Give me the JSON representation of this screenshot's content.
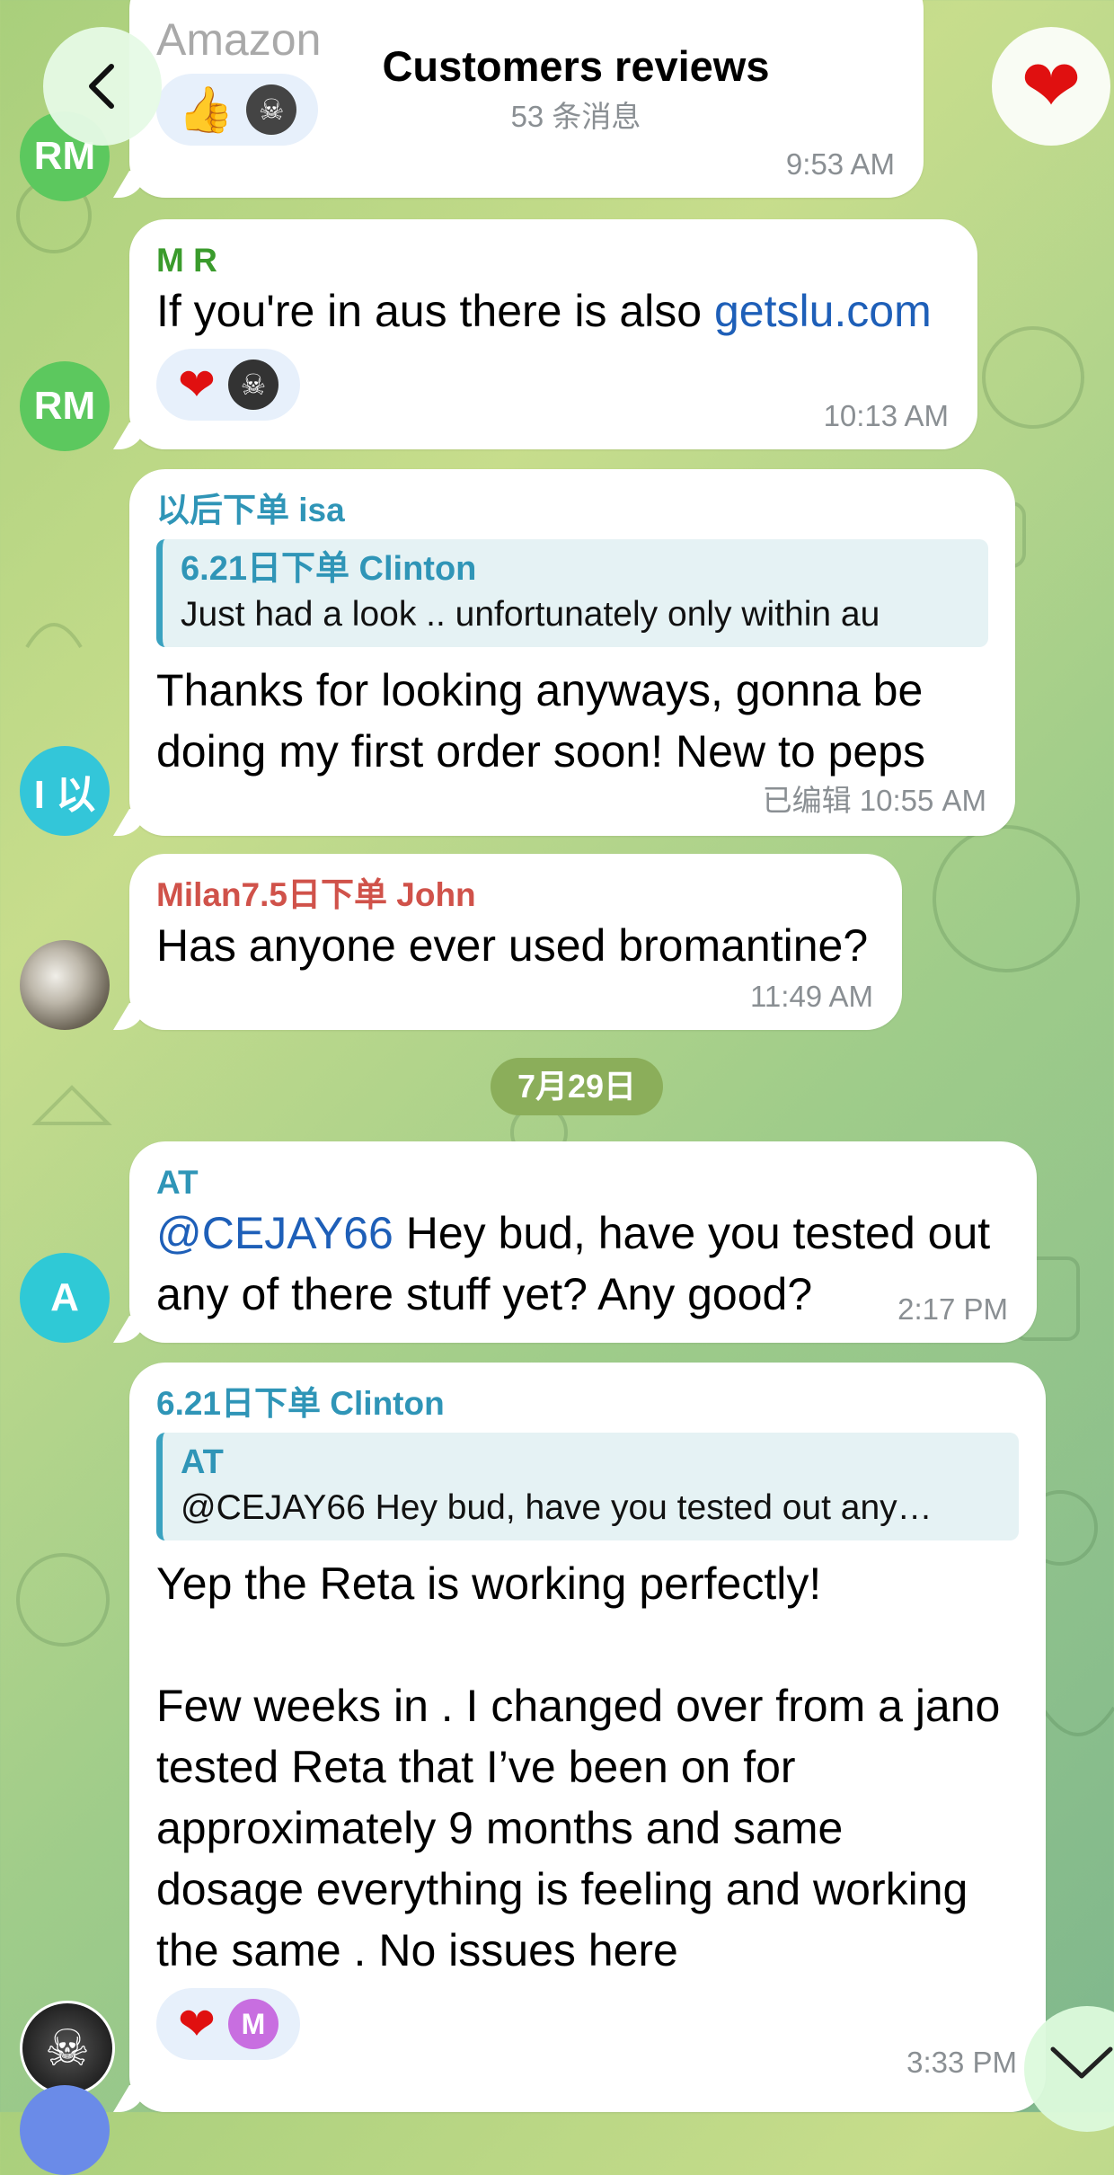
{
  "header": {
    "title": "Customers reviews",
    "subtitle": "53 条消息",
    "back_icon": "chevron-left-icon",
    "right_icon": "heart-icon"
  },
  "top_partial": {
    "text": "Amazon",
    "time": "9:53 AM",
    "avatar": "RM"
  },
  "messages": [
    {
      "sender": "M R",
      "text_plain": "If you're in aus there is also ",
      "link": "getslu.com",
      "time": "10:13 AM",
      "avatar": "RM"
    },
    {
      "sender": "以后下单 isa",
      "reply_name": "6.21日下单 Clinton",
      "reply_text": "Just had a look .. unfortunately only within au",
      "text": "Thanks for looking anyways, gonna be\ndoing my first order soon! New to peps",
      "time": "已编辑 10:55 AM",
      "avatar": "I 以"
    },
    {
      "sender": "Milan7.5日下单 John",
      "text": "Has anyone ever used bromantine?",
      "time": "11:49 AM"
    },
    {
      "sender": "AT",
      "mention": "@CEJAY66",
      "text": " Hey bud, have you tested out\nany of there stuff yet? Any good?",
      "time": "2:17 PM",
      "avatar": "A"
    },
    {
      "sender": "6.21日下单 Clinton",
      "reply_name": "AT",
      "reply_text": "@CEJAY66 Hey bud, have you tested out any…",
      "text": "Yep the Reta is working perfectly!\n\nFew weeks in . I changed over from a jano\ntested Reta that I’ve been on for\napproximately 9 months and same\ndosage everything is feeling and working\nthe same . No issues here",
      "time": "3:33 PM",
      "reaction_avatar": "M"
    }
  ],
  "date_separator": "7月29日",
  "colors": {
    "mr_sender": "#3a9b2c",
    "isa_sender": "#2f95b7",
    "milan_sender": "#d0524a",
    "at_sender": "#2f95b7",
    "clinton_sender": "#2f95b7",
    "rm_avatar": "#5cc85e",
    "isa_avatar": "#33c6d9",
    "at_avatar": "#2fc9d6",
    "m_avatar": "#c86ee0"
  }
}
